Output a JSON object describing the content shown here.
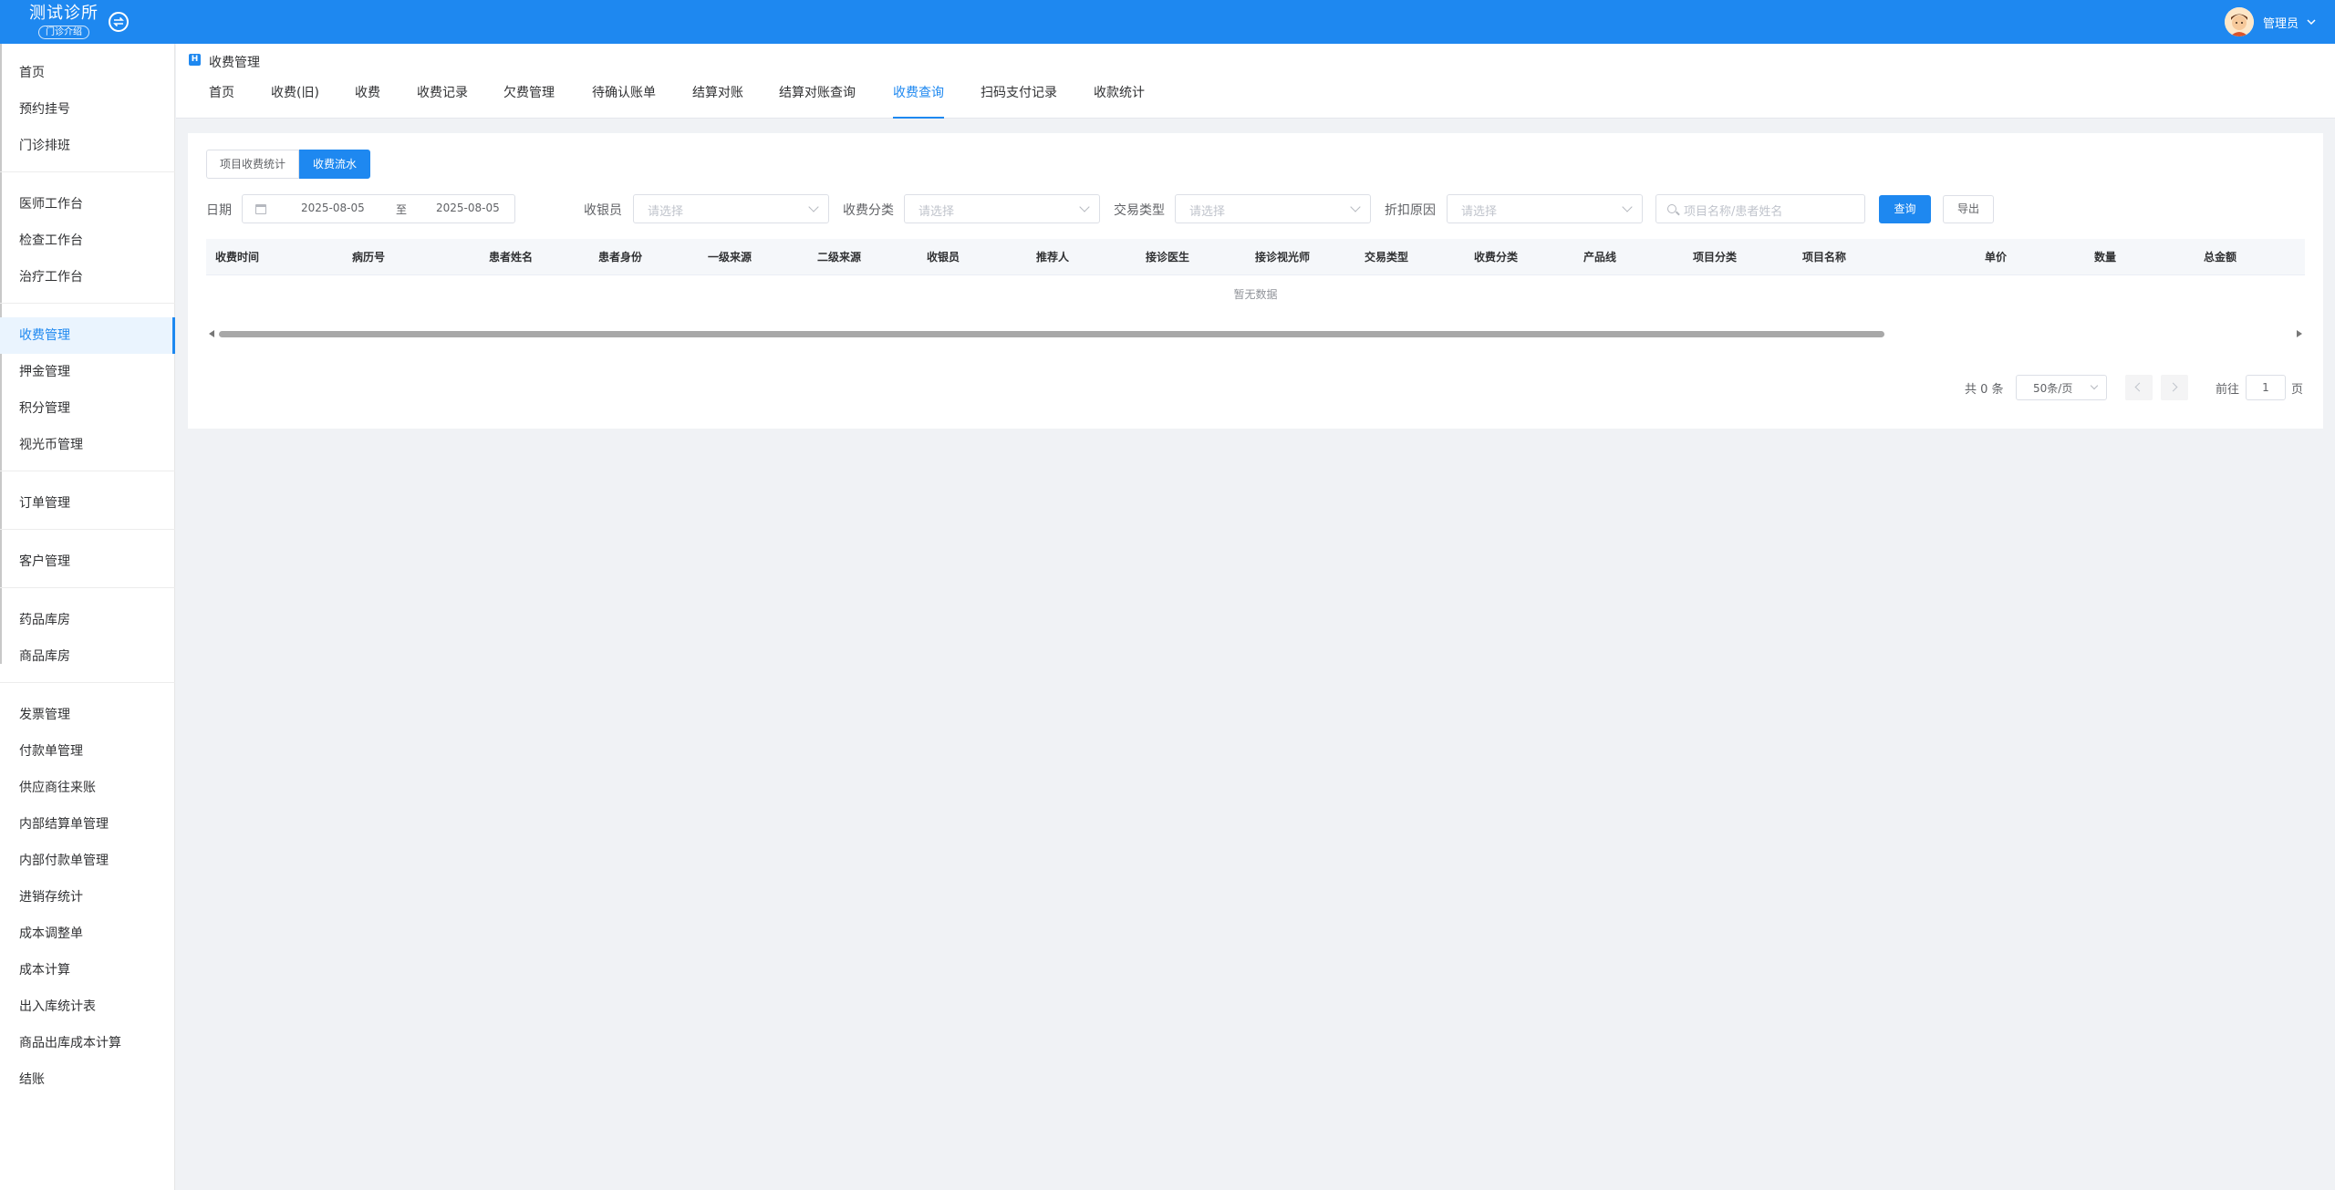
{
  "app": {
    "title": "测试诊所",
    "subtitle": "门诊介绍"
  },
  "user": {
    "name": "管理员"
  },
  "sidebar": {
    "items": [
      {
        "label": "首页"
      },
      {
        "label": "预约挂号"
      },
      {
        "label": "门诊排班"
      },
      {
        "label": "医师工作台"
      },
      {
        "label": "检查工作台"
      },
      {
        "label": "治疗工作台"
      },
      {
        "label": "收费管理",
        "active": true
      },
      {
        "label": "押金管理"
      },
      {
        "label": "积分管理"
      },
      {
        "label": "视光币管理"
      },
      {
        "label": "订单管理"
      },
      {
        "label": "客户管理"
      },
      {
        "label": "药品库房"
      },
      {
        "label": "商品库房"
      },
      {
        "label": "发票管理"
      },
      {
        "label": "付款单管理"
      },
      {
        "label": "供应商往来账"
      },
      {
        "label": "内部结算单管理"
      },
      {
        "label": "内部付款单管理"
      },
      {
        "label": "进销存统计"
      },
      {
        "label": "成本调整单"
      },
      {
        "label": "成本计算"
      },
      {
        "label": "出入库统计表"
      },
      {
        "label": "商品出库成本计算"
      },
      {
        "label": "结账"
      }
    ]
  },
  "page": {
    "title": "收费管理",
    "icon": "H"
  },
  "tabs": [
    {
      "label": "首页"
    },
    {
      "label": "收费(旧)"
    },
    {
      "label": "收费"
    },
    {
      "label": "收费记录"
    },
    {
      "label": "欠费管理"
    },
    {
      "label": "待确认账单"
    },
    {
      "label": "结算对账"
    },
    {
      "label": "结算对账查询"
    },
    {
      "label": "收费查询",
      "active": true
    },
    {
      "label": "扫码支付记录"
    },
    {
      "label": "收款统计"
    }
  ],
  "segment": {
    "options": [
      "项目收费统计",
      "收费流水"
    ],
    "active": 1
  },
  "filters": {
    "date_label": "日期",
    "date_start": "2025-08-05",
    "date_sep": "至",
    "date_end": "2025-08-05",
    "cashier_label": "收银员",
    "category_label": "收费分类",
    "trade_type_label": "交易类型",
    "discount_label": "折扣原因",
    "select_placeholder": "请选择",
    "search_placeholder": "项目名称/患者姓名",
    "query_button": "查询",
    "export_button": "导出"
  },
  "table": {
    "columns": [
      "收费时间",
      "病历号",
      "患者姓名",
      "患者身份",
      "一级来源",
      "二级来源",
      "收银员",
      "推荐人",
      "接诊医生",
      "接诊视光师",
      "交易类型",
      "收费分类",
      "产品线",
      "项目分类",
      "项目名称",
      "单价",
      "数量",
      "总金额"
    ],
    "empty_text": "暂无数据"
  },
  "pagination": {
    "total": "共 0 条",
    "page_size": "50条/页",
    "goto_label": "前往",
    "current_page": "1",
    "page_unit": "页"
  },
  "colors": {
    "primary": "#1e88f0",
    "sidebar_active_bg": "#eaf4fe"
  }
}
